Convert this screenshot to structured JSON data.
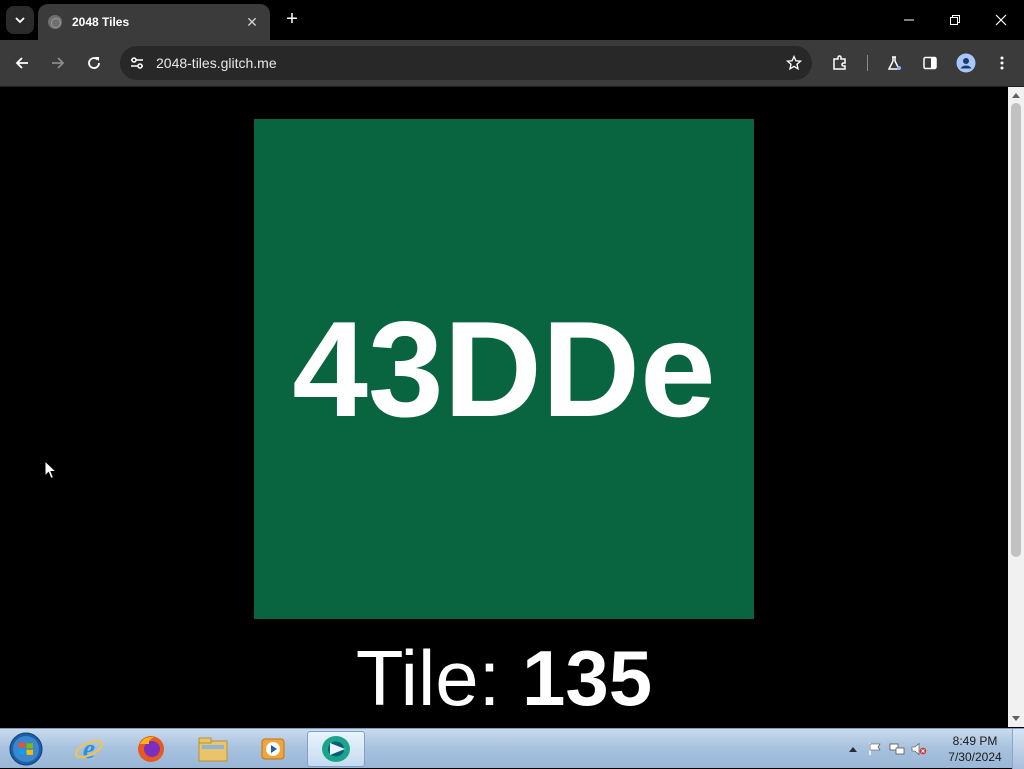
{
  "browser": {
    "tab_title": "2048 Tiles",
    "close_tab_symbol": "✕",
    "new_tab_symbol": "+",
    "url": "2048-tiles.glitch.me"
  },
  "page": {
    "tile_value": "43DDe",
    "tile_color": "#096440",
    "caption_label": "Tile: ",
    "caption_value": "135",
    "background": "#000000"
  },
  "taskbar": {
    "apps": [
      "start-orb",
      "internet-explorer-icon",
      "firefox-icon",
      "file-explorer-icon",
      "media-player-icon",
      "chrome-icon"
    ],
    "clock_time": "8:49 PM",
    "clock_date": "7/30/2024"
  }
}
